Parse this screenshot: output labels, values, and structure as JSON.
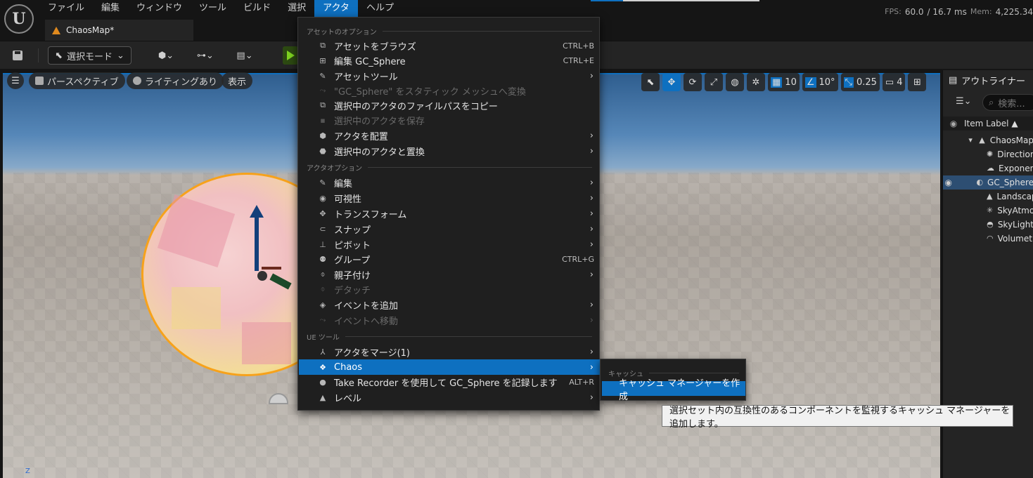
{
  "menubar": [
    "ファイル",
    "編集",
    "ウィンドウ",
    "ツール",
    "ビルド",
    "選択",
    "アクタ",
    "ヘルプ"
  ],
  "document_tab": "ChaosMap*",
  "stats": {
    "fps_label": "FPS:",
    "fps_value": "60.0",
    "frame_time": "/ 16.7 ms",
    "mem_label": "Mem:",
    "mem_value": "4,225.34"
  },
  "toolbar": {
    "mode_label": "選択モード"
  },
  "viewport": {
    "perspective": "パースペクティブ",
    "lighting": "ライティングあり",
    "show": "表示",
    "grid_snap": "10",
    "rot_snap": "10°",
    "scale_snap": "0.25",
    "camera_speed": "4",
    "axis_label": "Z"
  },
  "outliner": {
    "title": "アウトライナー",
    "search_placeholder": "検索...",
    "column": "Item Label ▲",
    "rows": [
      "ChaosMap",
      "DirectionalLight",
      "ExponentialHeightFog",
      "GC_Sphere",
      "Landscape",
      "SkyAtmosphere",
      "SkyLight",
      "VolumetricCloud"
    ]
  },
  "actor_menu": {
    "sec_asset": "アセットのオプション",
    "browse": "アセットをブラウズ",
    "browse_sc": "CTRL+B",
    "edit_asset": "編集 GC_Sphere",
    "edit_asset_sc": "CTRL+E",
    "asset_tools": "アセットツール",
    "convert_static": "\"GC_Sphere\" をスタティック メッシュへ変換",
    "copy_path": "選択中のアクタのファイルパスをコピー",
    "save_actor": "選択中のアクタを保存",
    "place_actor": "アクタを配置",
    "replace_actor": "選択中のアクタと置換",
    "sec_actor": "アクタオプション",
    "edit": "編集",
    "visibility": "可視性",
    "transform": "トランスフォーム",
    "snap": "スナップ",
    "pivot": "ピボット",
    "group": "グループ",
    "group_sc": "CTRL+G",
    "attach": "親子付け",
    "detach": "デタッチ",
    "add_event": "イベントを追加",
    "goto_event": "イベントへ移動",
    "sec_ue": "UE ツール",
    "merge": "アクタをマージ(1)",
    "chaos": "Chaos",
    "take_recorder": "Take Recorder を使用して GC_Sphere を記録します",
    "take_recorder_sc": "ALT+R",
    "level": "レベル"
  },
  "submenu": {
    "section": "キャッシュ",
    "item": "キャッシュ マネージャーを作成"
  },
  "tooltip": "選択セット内の互換性のあるコンポーネントを監視するキャッシュ マネージャーを追加します。",
  "colors": {
    "accent": "#0e70c0",
    "selection_outline": "#f7a21b"
  }
}
